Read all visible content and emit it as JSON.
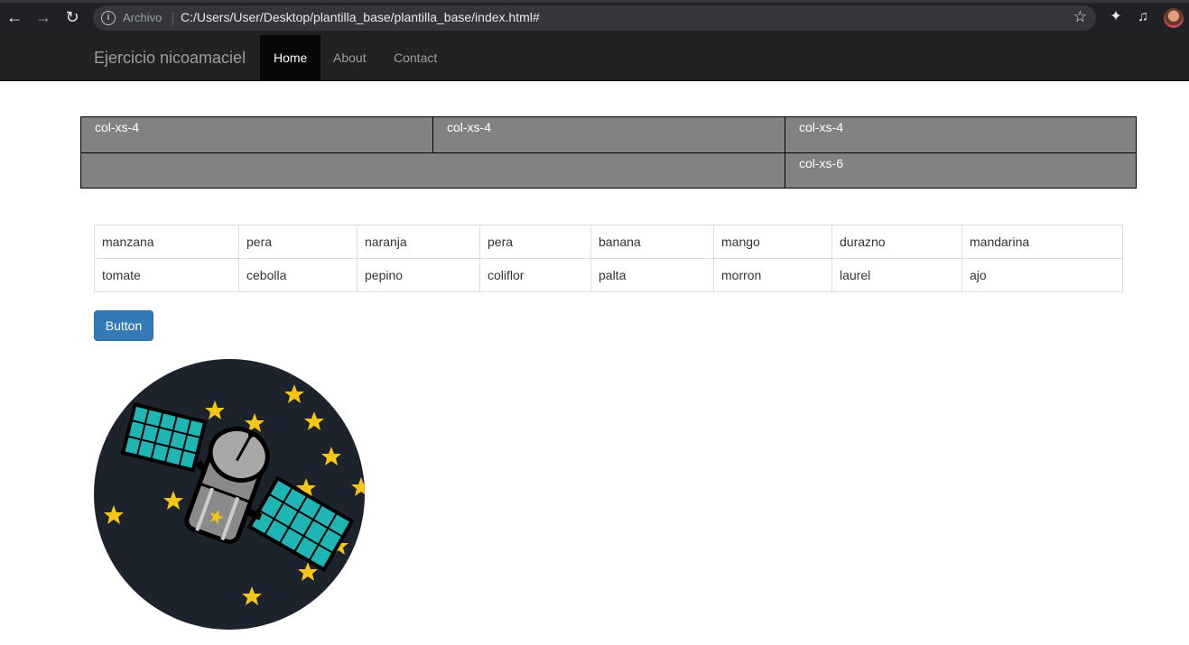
{
  "browser": {
    "back_icon": "arrow-left-icon",
    "forward_icon": "arrow-right-icon",
    "reload_icon": "reload-icon",
    "security_label": "Archivo",
    "url": "C:/Users/User/Desktop/plantilla_base/plantilla_base/index.html#"
  },
  "navbar": {
    "brand": "Ejercicio nicoamaciel",
    "items": [
      {
        "label": "Home",
        "active": true
      },
      {
        "label": "About",
        "active": false
      },
      {
        "label": "Contact",
        "active": false
      }
    ]
  },
  "grid": {
    "row1": [
      "col-xs-4",
      "col-xs-4",
      "col-xs-4"
    ],
    "row2": [
      "",
      "col-xs-6"
    ]
  },
  "table": {
    "rows": [
      [
        "manzana",
        "pera",
        "naranja",
        "pera",
        "banana",
        "mango",
        "durazno",
        "mandarina"
      ],
      [
        "tomate",
        "cebolla",
        "pepino",
        "coliflor",
        "palta",
        "morron",
        "laurel",
        "ajo"
      ]
    ]
  },
  "button": {
    "label": "Button"
  },
  "image": {
    "name": "satellite-illustration"
  },
  "colors": {
    "primary": "#337ab7",
    "navbar": "#222222",
    "grid_cell": "#828282"
  }
}
